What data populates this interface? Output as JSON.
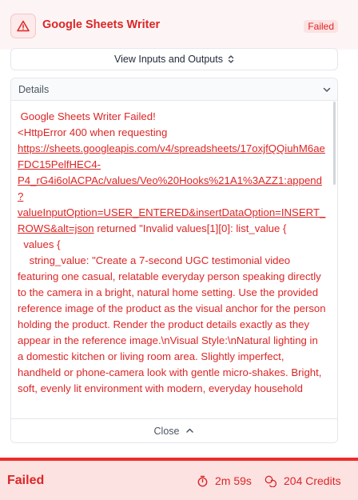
{
  "header": {
    "icon": "warning-triangle-icon",
    "title": "Google Sheets Writer",
    "status": "Failed"
  },
  "view_button": {
    "label": "View Inputs and Outputs",
    "icon": "chevrons-up-down-icon"
  },
  "details": {
    "label": "Details",
    "toggle_icon": "chevron-down-icon",
    "heading": " Google Sheets Writer Failed!",
    "prefix": "<HttpError 400 when requesting ",
    "url": "https://sheets.googleapis.com/v4/spreadsheets/17oxjfQQiuhM6aeFDC15PelfHEC4-P4_rG4i6olACPAc/values/Veo%20Hooks%21A1%3AZZ1:append?valueInputOption=USER_ENTERED&insertDataOption=INSERT_ROWS&alt=json",
    "after_url": " returned \"Invalid values[1][0]: list_value {\n  values {\n    string_value: \"Create a 7-second UGC testimonial video featuring one casual, relatable everyday person speaking directly to the camera in a bright, natural home setting. Use the provided reference image of the product as the visual anchor for the person holding the product. Render the product details exactly as they appear in the reference image.\\nVisual Style:\\nNatural lighting in a domestic kitchen or living room area. Slightly imperfect, handheld or phone-camera look with gentle micro-shakes. Bright, soft, evenly lit environment with modern, everyday household",
    "close_label": "Close",
    "close_icon": "chevron-up-icon"
  },
  "footer": {
    "status": "Failed",
    "duration": "2m 59s",
    "duration_icon": "stopwatch-icon",
    "credits": "204 Credits",
    "credits_icon": "coins-icon"
  },
  "colors": {
    "error": "#dc2626",
    "error_bar": "#ef2b2b",
    "footer_bg": "#fde2e2"
  }
}
